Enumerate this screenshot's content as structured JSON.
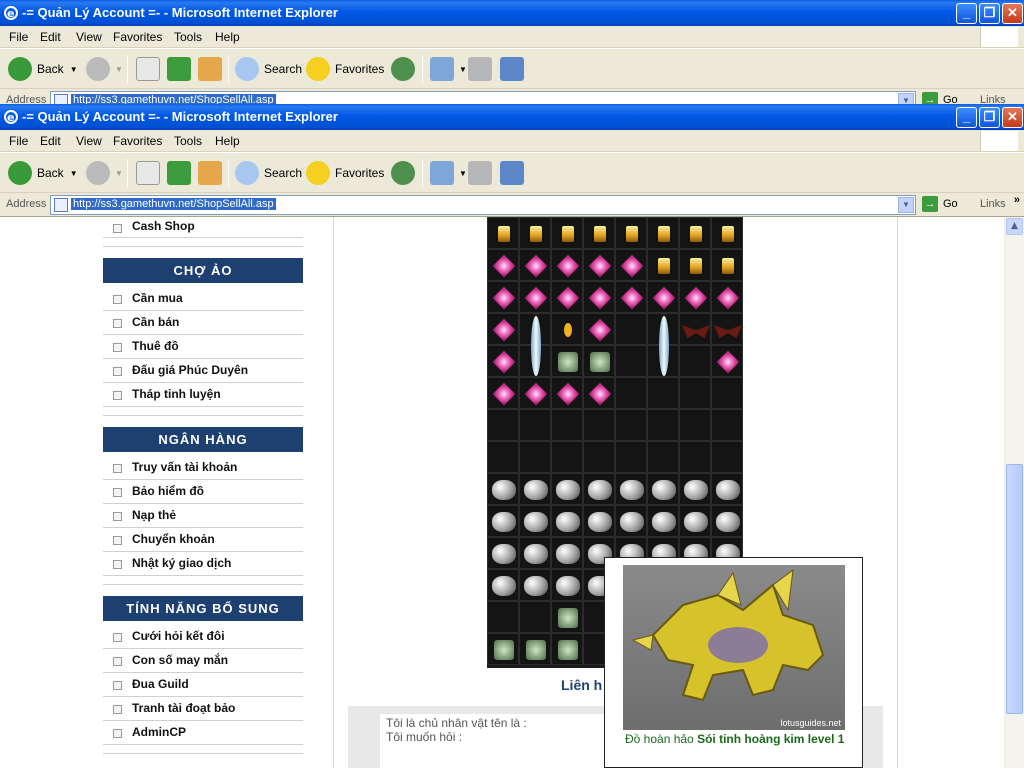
{
  "windows": [
    {
      "title": "-= Quản Lý Account =- - Microsoft Internet Explorer",
      "menu": [
        "File",
        "Edit",
        "View",
        "Favorites",
        "Tools",
        "Help"
      ],
      "toolbar": {
        "back": "Back",
        "search": "Search",
        "favorites": "Favorites"
      },
      "address": {
        "label": "Address",
        "url": "http://ss3.gamethuvn.net/ShopSellAll.asp",
        "go": "Go",
        "links": "Links"
      }
    },
    {
      "title": "-= Quản Lý Account =- - Microsoft Internet Explorer",
      "menu": [
        "File",
        "Edit",
        "View",
        "Favorites",
        "Tools",
        "Help"
      ],
      "toolbar": {
        "back": "Back",
        "search": "Search",
        "favorites": "Favorites"
      },
      "address": {
        "label": "Address",
        "url": "http://ss3.gamethuvn.net/ShopSellAll.asp",
        "go": "Go",
        "links": "Links"
      }
    }
  ],
  "sidebar": {
    "top_item": "Cash Shop",
    "sections": [
      {
        "title": "CHỢ ẢO",
        "items": [
          "Cần mua",
          "Cần bán",
          "Thuê đồ",
          "Đấu giá Phúc Duyên",
          "Tháp tinh luyện"
        ]
      },
      {
        "title": "NGÂN HÀNG",
        "items": [
          "Truy vấn tài khoản",
          "Bảo hiểm đồ",
          "Nạp thẻ",
          "Chuyển khoản",
          "Nhật ký giao dịch"
        ]
      },
      {
        "title": "TÍNH NĂNG BỔ SUNG",
        "items": [
          "Cưới hỏi kết đôi",
          "Con số may mắn",
          "Đua Guild",
          "Tranh tài đoạt bảo",
          "AdminCP"
        ]
      }
    ]
  },
  "inventory": {
    "rows": [
      [
        "gold",
        "gold",
        "gold",
        "gold",
        "gold",
        "gold",
        "gold",
        "gold"
      ],
      [
        "gem",
        "gem",
        "gem",
        "gem",
        "gem",
        "gold",
        "gold",
        "gold"
      ],
      [
        "gem",
        "gem",
        "gem",
        "gem",
        "gem",
        "gem",
        "gem",
        "gem"
      ],
      [
        "gem",
        "crystal",
        "coin",
        "gem",
        "empty",
        "crystal",
        "bat",
        "bat"
      ],
      [
        "gem",
        "empty",
        "misc",
        "misc",
        "empty",
        "empty",
        "empty",
        "gem"
      ],
      [
        "gem",
        "gem",
        "gem",
        "gem",
        "empty",
        "empty",
        "empty",
        "empty"
      ],
      [
        "empty",
        "empty",
        "empty",
        "empty",
        "empty",
        "empty",
        "empty",
        "empty"
      ],
      [
        "empty",
        "empty",
        "empty",
        "empty",
        "empty",
        "empty",
        "empty",
        "empty"
      ],
      [
        "ore",
        "ore",
        "ore",
        "ore",
        "ore",
        "ore",
        "ore",
        "ore"
      ],
      [
        "ore",
        "ore",
        "ore",
        "ore",
        "ore",
        "ore",
        "ore",
        "ore"
      ],
      [
        "ore",
        "ore",
        "ore",
        "ore",
        "ore",
        "ore",
        "ore",
        "ore"
      ],
      [
        "ore",
        "ore",
        "ore",
        "ore",
        "ore",
        "ore",
        "ore",
        "ore"
      ],
      [
        "empty",
        "empty",
        "misc",
        "empty",
        "empty",
        "empty",
        "empty",
        "empty"
      ],
      [
        "misc",
        "misc",
        "misc",
        "empty",
        "empty",
        "empty",
        "empty",
        "empty"
      ]
    ]
  },
  "lienhe": "Liên h",
  "contact": {
    "line1": "Tôi là chủ  nhân vật tên là :",
    "line2": "Tôi muốn hỏi :"
  },
  "tooltip": {
    "prefix": "Đồ hoàn hảo",
    "name": "Sói tinh hoàng kim level 1",
    "watermark": "lotusguides.net"
  }
}
